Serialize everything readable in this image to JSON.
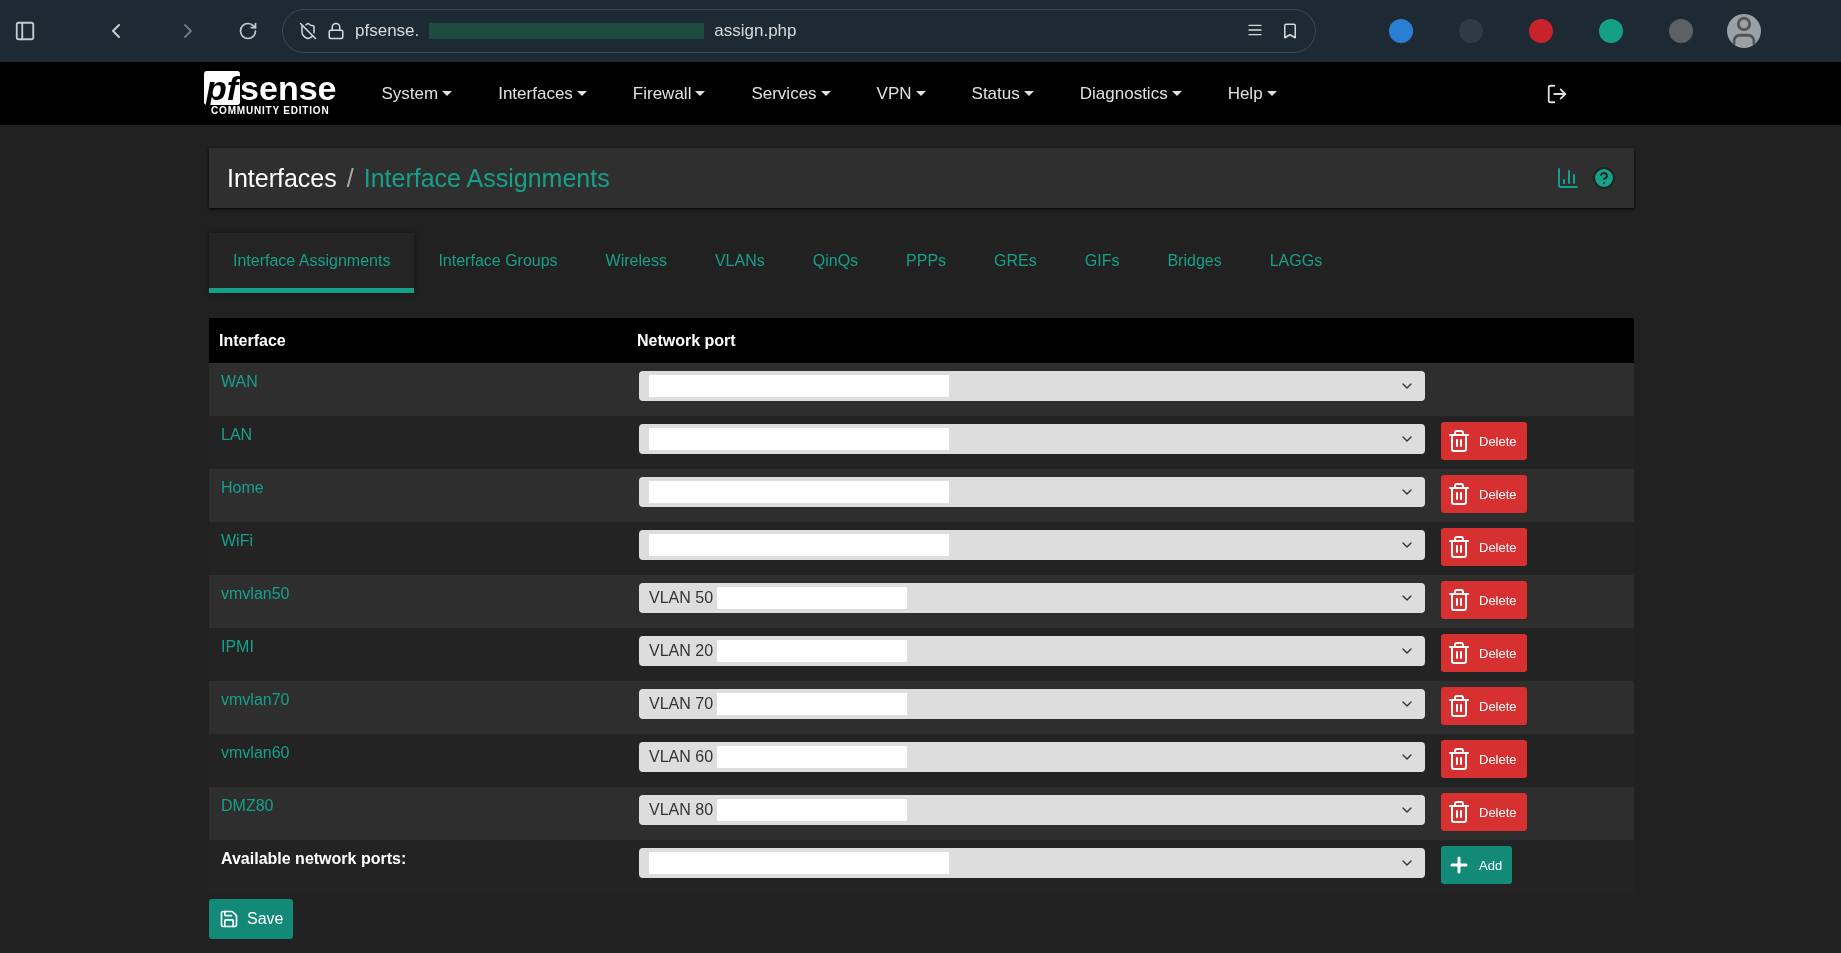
{
  "browser": {
    "url_start": "pfsense.",
    "url_end": "assign.php",
    "url_redacted": true
  },
  "navbar": {
    "logo": "sense",
    "logo_mark": "pf",
    "logo_sub": "COMMUNITY EDITION",
    "menus": [
      "System",
      "Interfaces",
      "Firewall",
      "Services",
      "VPN",
      "Status",
      "Diagnostics",
      "Help"
    ]
  },
  "breadcrumb": {
    "parent": "Interfaces",
    "separator": "/",
    "current": "Interface Assignments"
  },
  "tabs": [
    {
      "label": "Interface Assignments",
      "selected": true
    },
    {
      "label": "Interface Groups",
      "selected": false
    },
    {
      "label": "Wireless",
      "selected": false
    },
    {
      "label": "VLANs",
      "selected": false
    },
    {
      "label": "QinQs",
      "selected": false
    },
    {
      "label": "PPPs",
      "selected": false
    },
    {
      "label": "GREs",
      "selected": false
    },
    {
      "label": "GIFs",
      "selected": false
    },
    {
      "label": "Bridges",
      "selected": false
    },
    {
      "label": "LAGGs",
      "selected": false
    }
  ],
  "table": {
    "columns": [
      "Interface",
      "Network port"
    ],
    "rows": [
      {
        "interface": "WAN",
        "redacted": true
      },
      {
        "interface": "LAN",
        "redacted": true,
        "action": "Delete"
      },
      {
        "interface": "Home",
        "redacted": true,
        "action": "Delete"
      },
      {
        "interface": "WiFi",
        "redacted": true,
        "action": "Delete"
      },
      {
        "interface": "vmvlan50",
        "port": "VLAN 50",
        "redacted": true,
        "action": "Delete"
      },
      {
        "interface": "IPMI",
        "port": "VLAN 20",
        "redacted": true,
        "action": "Delete"
      },
      {
        "interface": "vmvlan70",
        "port": "VLAN 70",
        "redacted": true,
        "action": "Delete"
      },
      {
        "interface": "vmvlan60",
        "port": "VLAN 60",
        "redacted": true,
        "action": "Delete"
      },
      {
        "interface": "DMZ80",
        "port": "VLAN 80",
        "redacted": true,
        "action": "Delete"
      }
    ],
    "available": {
      "label": "Available network ports:",
      "redacted": true,
      "action": "Add"
    }
  },
  "save_button": "Save"
}
